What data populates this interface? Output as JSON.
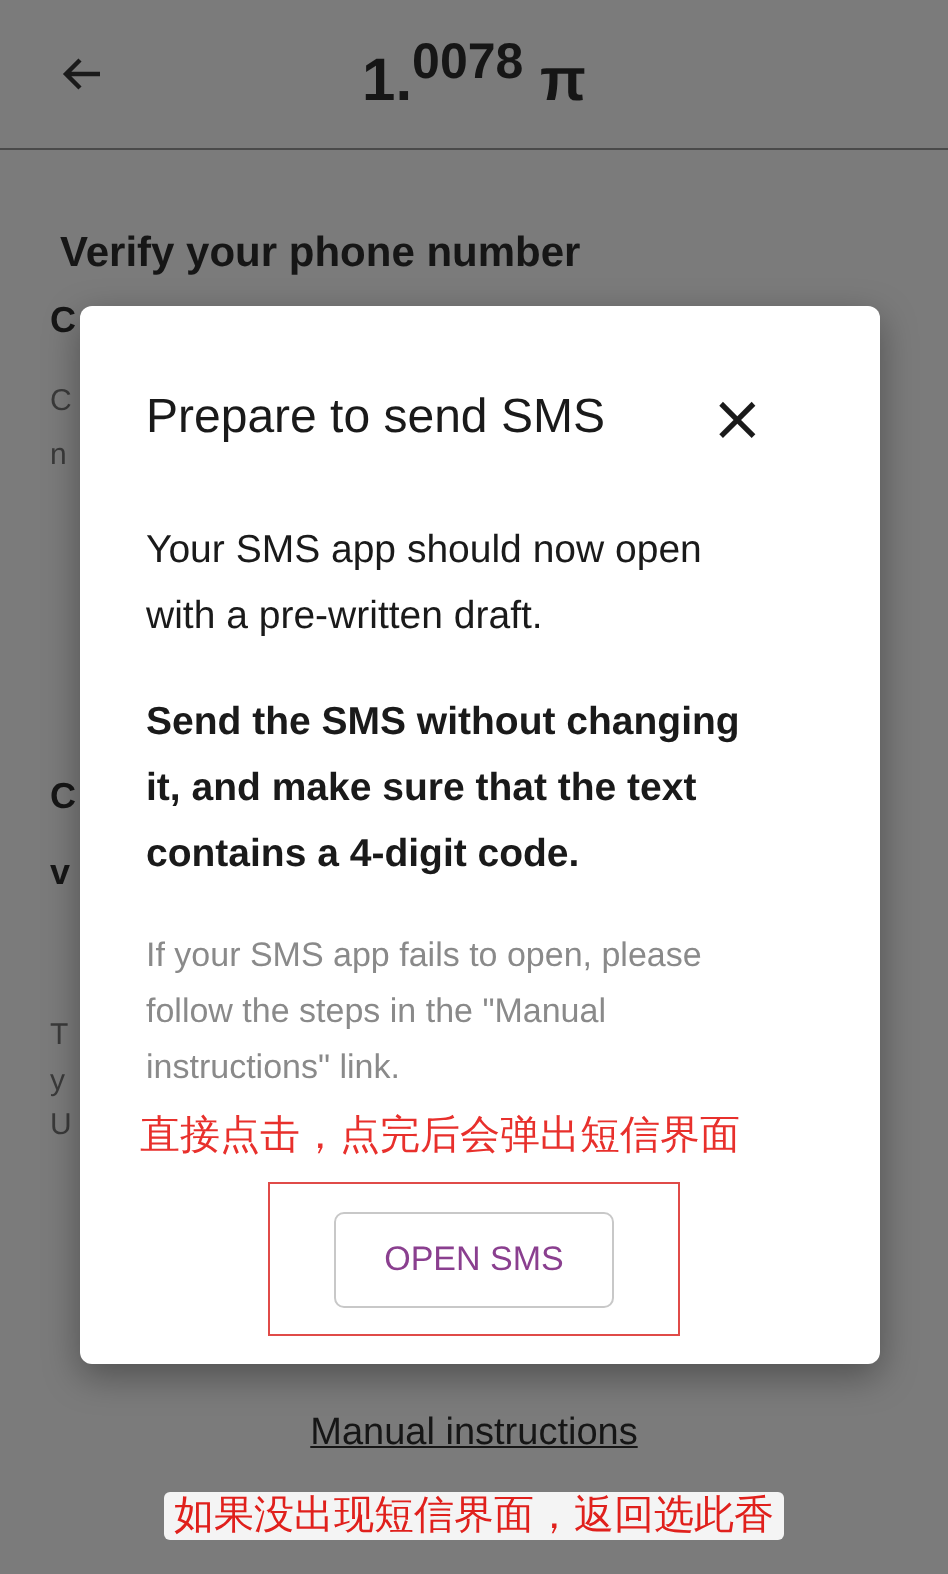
{
  "top_bar": {
    "title": "1.$^{0078}$ π"
  },
  "page": {
    "heading": "Verify your phone number",
    "fragments": [
      {
        "text": "C",
        "kind": "bold"
      },
      {
        "text": "C",
        "kind": "muted"
      },
      {
        "text": "n",
        "kind": "muted"
      },
      {
        "text": "C",
        "kind": "bold"
      },
      {
        "text": "v",
        "kind": "bold"
      },
      {
        "text": "T",
        "kind": "muted"
      },
      {
        "text": "y",
        "kind": "muted"
      },
      {
        "text": "U",
        "kind": "muted"
      }
    ],
    "link": "Manual instructions"
  },
  "dialog": {
    "title": "Prepare to send SMS",
    "close": "×",
    "paragraphs": [
      {
        "text": "Your SMS app should now open with a pre-written draft.",
        "kind": "normal"
      },
      {
        "text": "Send the SMS without changing it, and make sure that the text contains a 4-digit code.",
        "kind": "bold"
      },
      {
        "text": "If your SMS app fails to open, please follow the steps in the \"Manual instructions\" link.",
        "kind": "muted"
      }
    ],
    "button": "OPEN SMS"
  },
  "annotations": [
    {
      "text": "直接点击，点完后会弹出短信界面"
    },
    {
      "text": "如果没出现短信界面，返回选此香"
    }
  ]
}
